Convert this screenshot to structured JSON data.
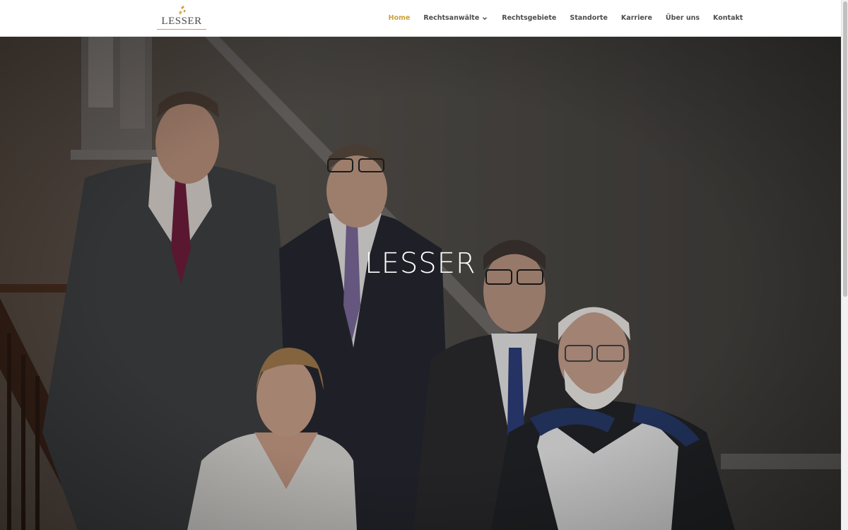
{
  "header": {
    "logo_text": "LESSER",
    "nav": {
      "home": "Home",
      "rechtsanwaelte": "Rechtsanwälte",
      "rechtsgebiete": "Rechtsgebiete",
      "standorte": "Standorte",
      "karriere": "Karriere",
      "ueber_uns": "Über uns",
      "kontakt": "Kontakt"
    },
    "active_item": "Home",
    "dropdown_icon": "chevron-down-icon"
  },
  "hero": {
    "title": "LESSER",
    "background_image": "team-photo"
  },
  "colors": {
    "accent": "#c9a23b",
    "nav_text": "#4d4d4d",
    "hero_title": "#ffffff"
  }
}
